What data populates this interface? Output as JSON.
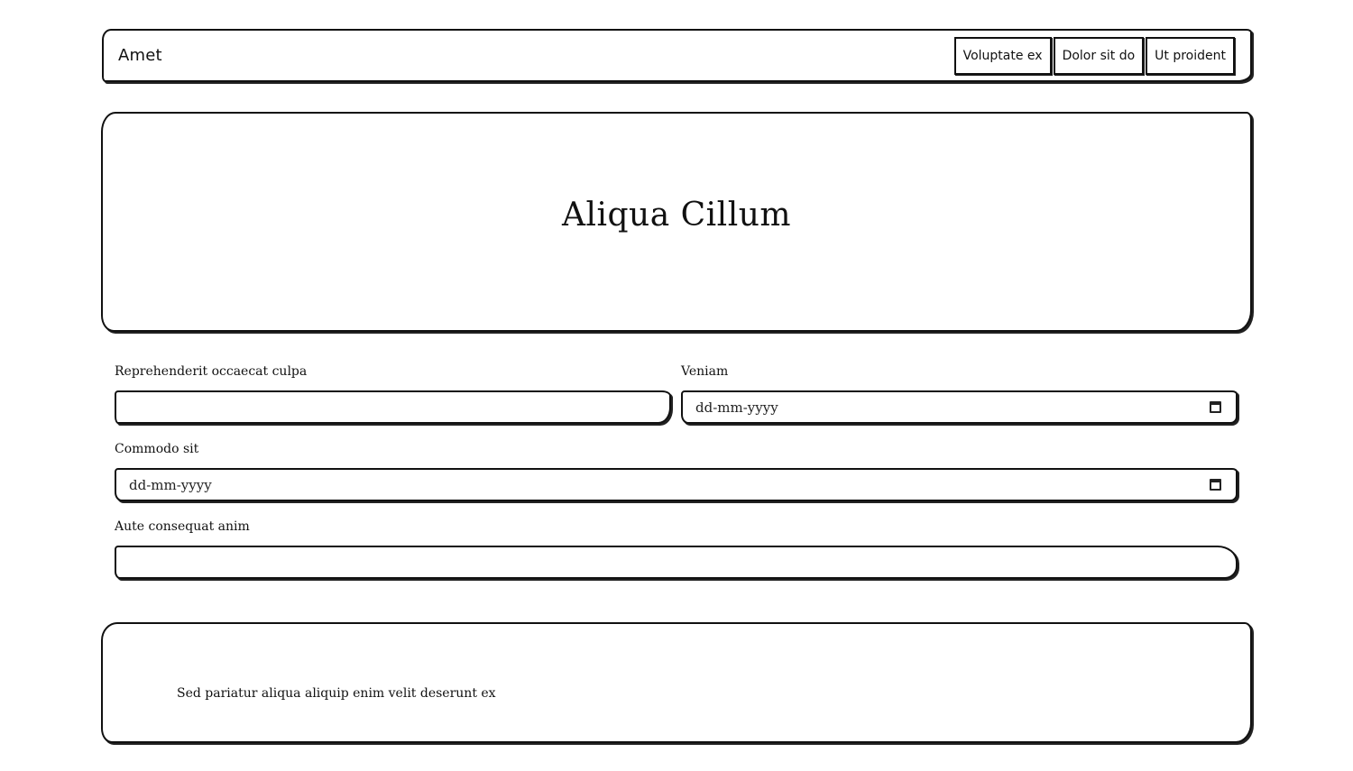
{
  "header": {
    "brand": "Amet",
    "nav": [
      {
        "label": "Voluptate ex"
      },
      {
        "label": "Dolor sit do"
      },
      {
        "label": "Ut proident"
      }
    ]
  },
  "hero": {
    "title": "Aliqua Cillum"
  },
  "form": {
    "fields": [
      {
        "label": "Reprehenderit occaecat culpa",
        "type": "text",
        "value": "",
        "placeholder": ""
      },
      {
        "label": "Veniam",
        "type": "date",
        "value": "",
        "placeholder": "dd-mm-yyyy"
      },
      {
        "label": "Commodo sit",
        "type": "date",
        "value": "",
        "placeholder": "dd-mm-yyyy"
      },
      {
        "label": "Aute consequat anim",
        "type": "text",
        "value": "",
        "placeholder": ""
      }
    ]
  },
  "footer": {
    "text": "Sed pariatur aliqua aliquip enim velit deserunt ex"
  },
  "icons": {
    "date_picker": "calendar-icon"
  }
}
